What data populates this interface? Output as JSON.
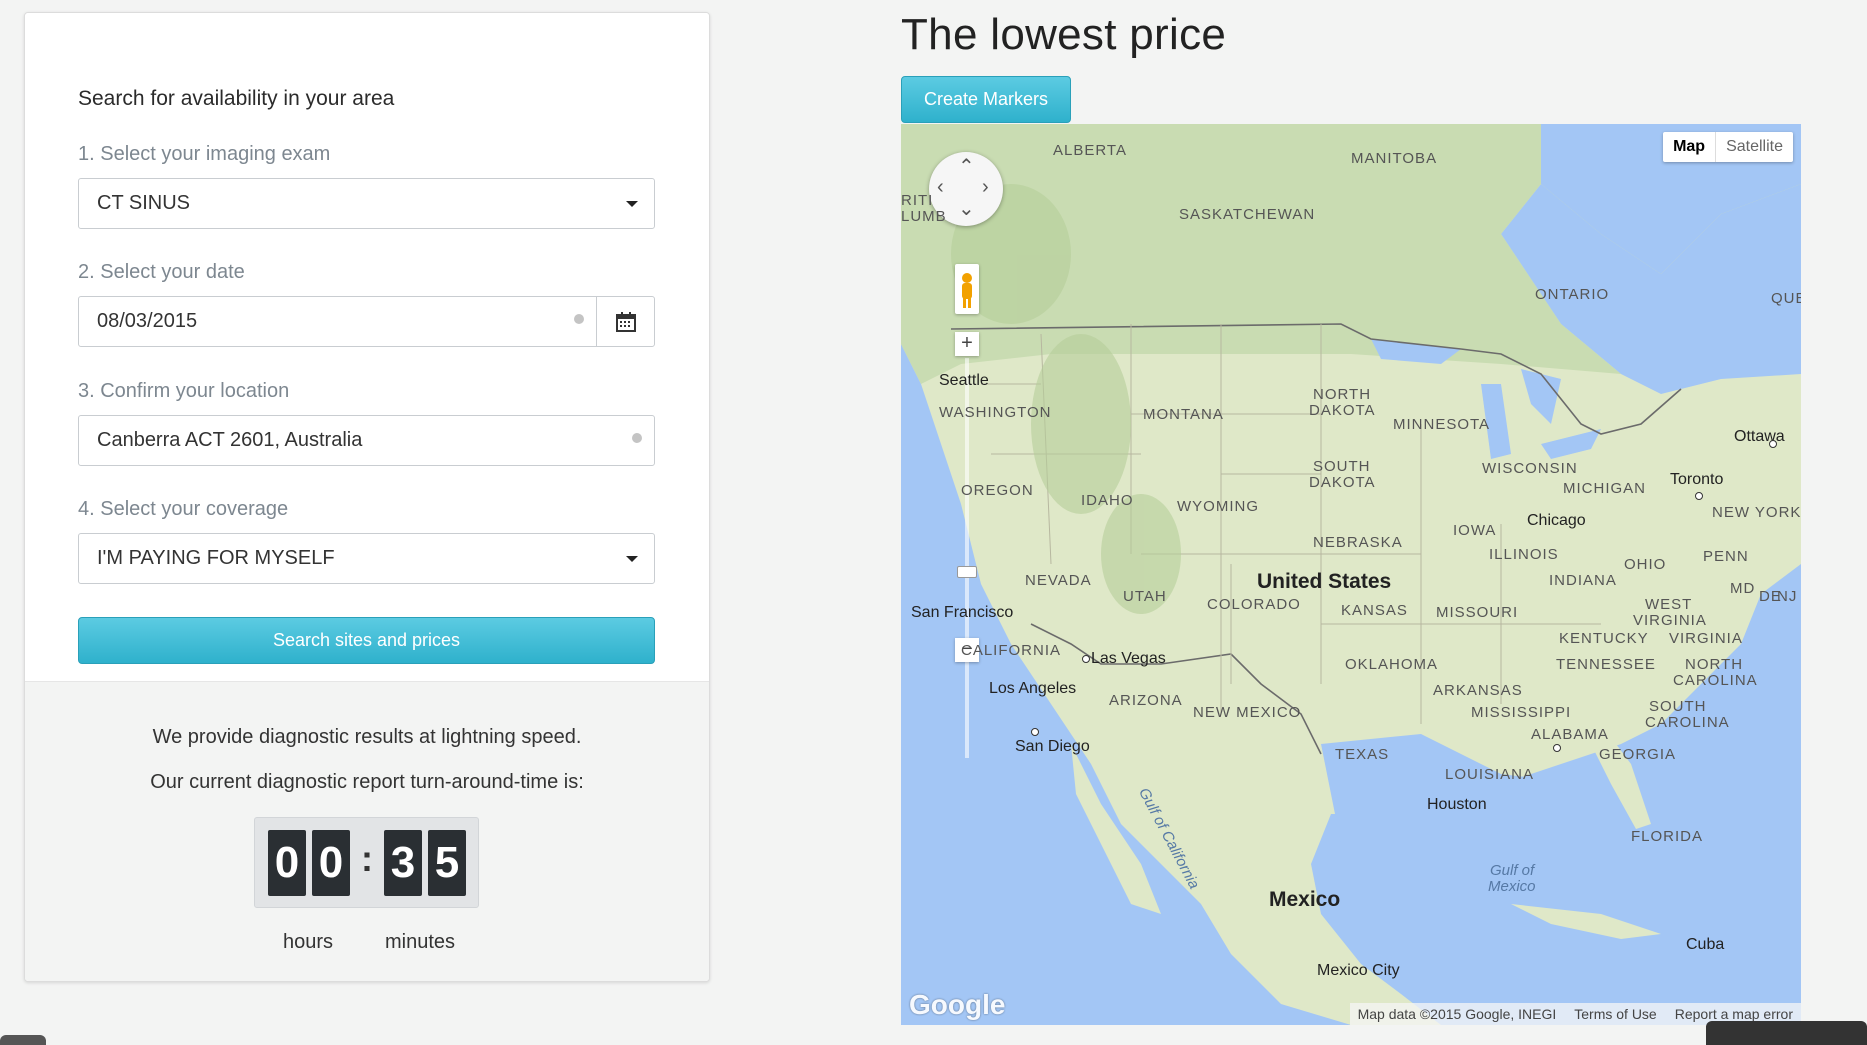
{
  "search": {
    "heading": "Search for availability in your area",
    "step1_label": "1. Select your imaging exam",
    "exam_value": "CT SINUS",
    "step2_label": "2. Select your date",
    "date_value": "08/03/2015",
    "step3_label": "3. Confirm your location",
    "location_value": "Canberra ACT 2601, Australia",
    "step4_label": "4. Select your coverage",
    "coverage_value": "I'M PAYING FOR MYSELF",
    "search_button": "Search sites and prices"
  },
  "info": {
    "line1": "We provide diagnostic results at lightning speed.",
    "line2": "Our current diagnostic report turn-around-time is:",
    "timer": {
      "h1": "0",
      "h2": "0",
      "m1": "3",
      "m2": "5",
      "separator": ":"
    },
    "hours_label": "hours",
    "minutes_label": "minutes"
  },
  "right": {
    "title": "The lowest price",
    "create_markers": "Create Markers"
  },
  "map": {
    "type_map": "Map",
    "type_satellite": "Satellite",
    "regions": [
      "ALBERTA",
      "MANITOBA",
      "SASKATCHEWAN",
      "ONTARIO",
      "QUE",
      "RITI",
      "LUMB",
      "WASHINGTON",
      "MONTANA",
      "NORTH",
      "DAKOTA",
      "MINNESOTA",
      "SOUTH",
      "DAKOTA",
      "WISCONSIN",
      "MICHIGAN",
      "OREGON",
      "IDAHO",
      "WYOMING",
      "IOWA",
      "NEW YORK",
      "NEBRASKA",
      "ILLINOIS",
      "OHIO",
      "PENN",
      "NEVADA",
      "UTAH",
      "COLORADO",
      "KANSAS",
      "MISSOURI",
      "INDIANA",
      "MD",
      "DE",
      "NJ",
      "WEST",
      "VIRGINIA",
      "VIRGINIA",
      "KENTUCKY",
      "CALIFORNIA",
      "OKLAHOMA",
      "TENNESSEE",
      "NORTH",
      "CAROLINA",
      "ARIZONA",
      "NEW MEXICO",
      "ARKANSAS",
      "MISSISSIPPI",
      "SOUTH",
      "CAROLINA",
      "ALABAMA",
      "GEORGIA",
      "TEXAS",
      "LOUISIANA",
      "FLORIDA"
    ],
    "cities": [
      "Seattle",
      "Ottawa",
      "Toronto",
      "Chicago",
      "San Francisco",
      "Las Vegas",
      "Los Angeles",
      "San Diego",
      "Houston",
      "Mexico City",
      "Cuba"
    ],
    "countries": [
      "United States",
      "Mexico"
    ],
    "water": [
      "Gulf of California",
      "Gulf of",
      "Mexico"
    ],
    "logo": "Google",
    "attribution": [
      "Map data ©2015 Google, INEGI",
      "Terms of Use",
      "Report a map error"
    ],
    "zoom_in": "+",
    "zoom_out": "−"
  },
  "colors": {
    "accent": "#3bbcd6",
    "map_water": "#a3c6f5",
    "map_land": "#e9ecd9"
  }
}
